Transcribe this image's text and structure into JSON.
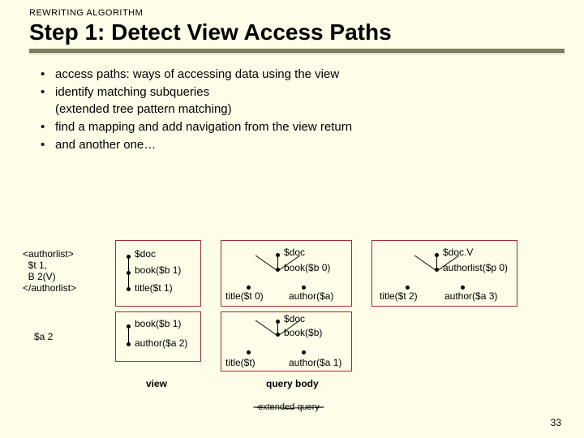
{
  "kicker": "REWRITING ALGORITHM",
  "title": "Step 1: Detect View Access Paths",
  "bullets": [
    "access paths: ways of accessing data using the view",
    "identify matching subqueries\n(extended tree pattern matching)",
    "find a mapping and add navigation from the view return",
    "and another one…"
  ],
  "codeBlock": "<authorlist>\n  $t 1,\n  B 2(V)\n</authorlist>",
  "codeVar": "$a 2",
  "trees": {
    "t1": {
      "n1": "$doc",
      "n2": "book($b 1)",
      "n3": "title($t 1)"
    },
    "t2": {
      "n1": "book($b 1)",
      "n2": "author($a 2)"
    },
    "t3": {
      "n1": "$doc",
      "n2": "book($b 0)",
      "l1": "title($t 0)",
      "l2": "author($a)"
    },
    "t4": {
      "n1": "$doc",
      "n2": "book($b)",
      "l1": "title($t)",
      "l2": "author($a 1)"
    },
    "t5": {
      "n1": "$doc.V",
      "n2": "authorlist($p 0)",
      "l1": "title($t 2)",
      "l2": "author($a 3)"
    }
  },
  "captions": {
    "view": "view",
    "body": "query body",
    "ext": "extended query"
  },
  "slide_num": "33"
}
